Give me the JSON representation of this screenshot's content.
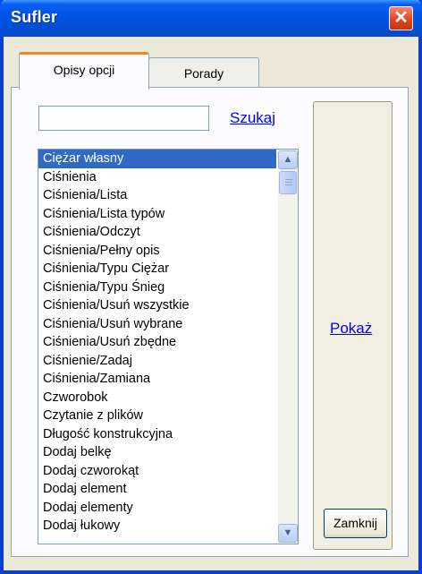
{
  "window": {
    "title": "Sufler",
    "close_glyph": "✕"
  },
  "tabs": [
    {
      "label": "Opisy opcji",
      "active": true
    },
    {
      "label": "Porady",
      "active": false
    }
  ],
  "search": {
    "value": "",
    "link_label": "Szukaj"
  },
  "list": {
    "selected_index": 0,
    "items": [
      "Ciężar własny",
      "Ciśnienia",
      "Ciśnienia/Lista",
      "Ciśnienia/Lista typów",
      "Ciśnienia/Odczyt",
      "Ciśnienia/Pełny opis",
      "Ciśnienia/Typu Ciężar",
      "Ciśnienia/Typu Śnieg",
      "Ciśnienia/Usuń wszystkie",
      "Ciśnienia/Usuń wybrane",
      "Ciśnienia/Usuń zbędne",
      "Ciśnienie/Zadaj",
      "Ciśnienia/Zamiana",
      "Czworobok",
      "Czytanie z plików",
      "Długość konstrukcyjna",
      "Dodaj belkę",
      "Dodaj czworokąt",
      "Dodaj element",
      "Dodaj elementy",
      "Dodaj łukowy"
    ]
  },
  "scrollbar": {
    "up_glyph": "▲",
    "down_glyph": "▼",
    "position": 0.0
  },
  "buttons": {
    "show_label": "Pokaż",
    "close_label": "Zamknij"
  },
  "colors": {
    "selection": "#316ac5",
    "titlebar": "#0054e3",
    "link": "#0000ff"
  }
}
